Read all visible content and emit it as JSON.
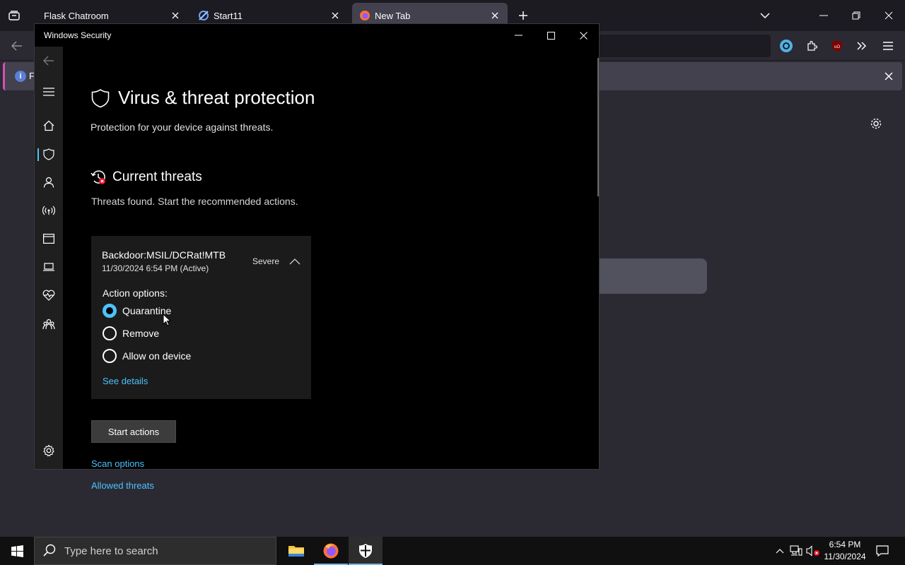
{
  "browser": {
    "tabs": [
      {
        "title": "Flask Chatroom"
      },
      {
        "title": "Start11"
      },
      {
        "title": "New Tab"
      }
    ],
    "notification_text": "F"
  },
  "windows_security": {
    "window_title": "Windows Security",
    "page_title": "Virus & threat protection",
    "page_subtitle": "Protection for your device against threats.",
    "current_threats": {
      "heading": "Current threats",
      "subtitle": "Threats found. Start the recommended actions.",
      "threat": {
        "name": "Backdoor:MSIL/DCRat!MTB",
        "timestamp": "11/30/2024 6:54 PM (Active)",
        "severity": "Severe",
        "action_options_label": "Action options:",
        "options": [
          {
            "label": "Quarantine",
            "selected": true
          },
          {
            "label": "Remove",
            "selected": false
          },
          {
            "label": "Allow on device",
            "selected": false
          }
        ],
        "see_details": "See details"
      }
    },
    "start_actions_label": "Start actions",
    "links": {
      "scan_options": "Scan options",
      "allowed_threats": "Allowed threats"
    },
    "sidebar_icons": [
      "back-icon",
      "menu-icon",
      "home-icon",
      "shield-icon",
      "person-icon",
      "wireless-icon",
      "app-browser-icon",
      "laptop-icon",
      "heart-icon",
      "family-icon",
      "gear-icon"
    ]
  },
  "taskbar": {
    "search_placeholder": "Type here to search",
    "clock_time": "6:54 PM",
    "clock_date": "11/30/2024"
  },
  "colors": {
    "accent": "#4cc2ff",
    "threat_icon": "#e81123"
  }
}
